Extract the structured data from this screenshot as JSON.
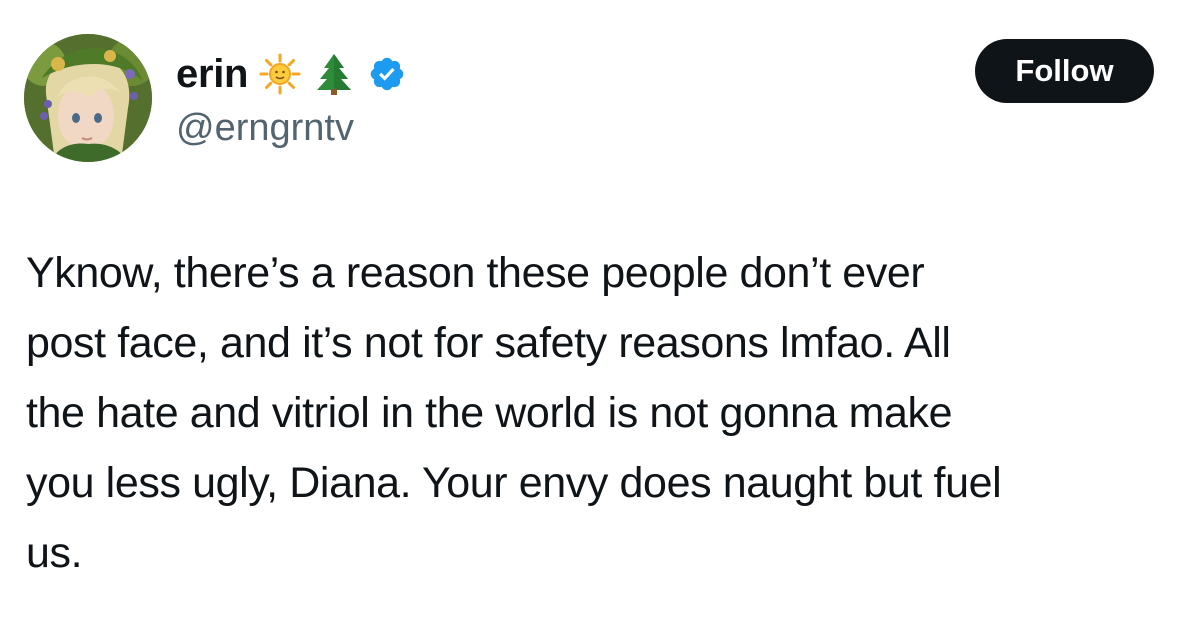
{
  "author": {
    "display_name": "erin",
    "emoji_1": "sun-emoji",
    "emoji_2": "evergreen-tree-emoji",
    "verified_icon": "verified-badge-icon",
    "handle": "@erngrntv",
    "avatar_icon": "avatar-portrait"
  },
  "actions": {
    "follow_label": "Follow"
  },
  "tweet": {
    "lines": [
      "Yknow, there’s a reason these people don’t ever",
      "post face, and it’s not for safety reasons lmfao. All",
      "the hate and vitriol in the world is not gonna make",
      "you less ugly, Diana. Your envy does naught but fuel",
      "us."
    ]
  },
  "colors": {
    "text": "#0f1419",
    "secondary_text": "#536471",
    "button_bg": "#0f1419",
    "verified_blue": "#1d9bf0"
  }
}
